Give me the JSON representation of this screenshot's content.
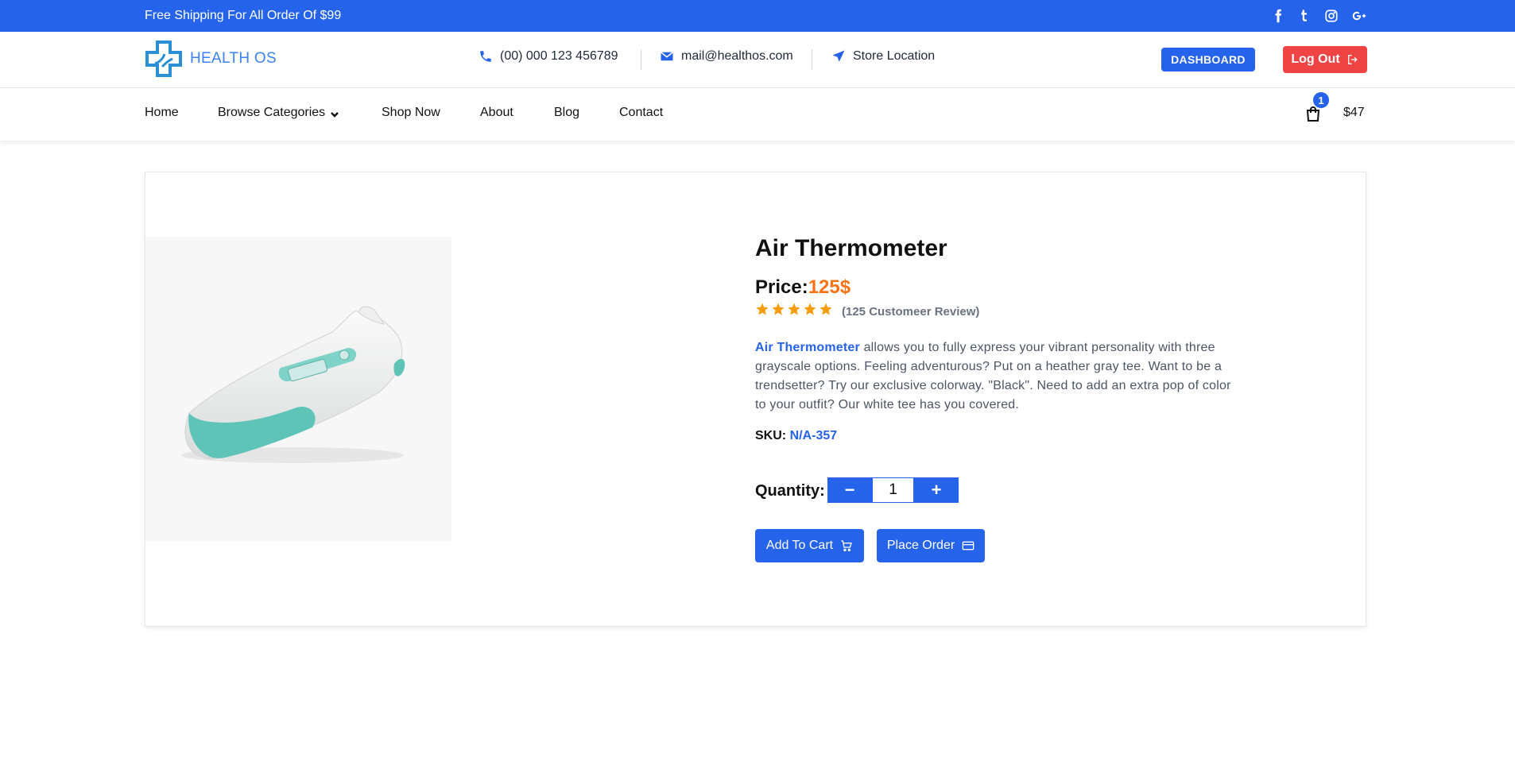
{
  "topbar": {
    "shipping_text": "Free Shipping For All Order Of $99",
    "social": [
      "facebook-icon",
      "tumblr-icon",
      "instagram-icon",
      "google-plus-icon"
    ]
  },
  "header": {
    "brand": "HEALTH OS",
    "phone": "(00) 000 123 456789",
    "email": "mail@healthos.com",
    "store_location": "Store Location",
    "dashboard_label": "DASHBOARD",
    "logout_label": "Log Out"
  },
  "nav": {
    "items": [
      "Home",
      "Browse Categories",
      "Shop Now",
      "About",
      "Blog",
      "Contact"
    ],
    "cart_count": "1",
    "cart_total": "$47"
  },
  "product": {
    "title": "Air Thermometer",
    "price_label": "Price:",
    "price_value": "125$",
    "rating": 5,
    "reviews": "(125 Customeer Review)",
    "desc_highlight": "Air Thermometer",
    "desc_rest": " allows you to fully express your vibrant personality with three grayscale options. Feeling adventurous? Put on a heather gray tee. Want to be a trendsetter? Try our exclusive colorway. \"Black\". Need to add an extra pop of color to your outfit? Our white tee has you covered.",
    "sku_label": "SKU:",
    "sku_value": "N/A-357",
    "quantity_label": "Quantity:",
    "quantity": "1",
    "add_to_cart": "Add To Cart",
    "place_order": "Place Order"
  },
  "colors": {
    "primary": "#2563eb",
    "danger": "#ef4444",
    "price": "#f97316",
    "star": "#f59e0b"
  }
}
